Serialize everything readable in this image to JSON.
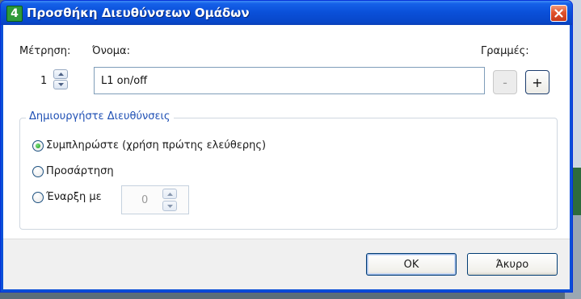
{
  "window": {
    "title": "Προσθήκη Διευθύνσεων Ομάδων",
    "app_icon_glyph": "4",
    "close_glyph": "✕"
  },
  "form": {
    "count_label": "Μέτρηση:",
    "count_value": "1",
    "name_label": "Όνομα:",
    "name_value": "L1 on/off",
    "lines_label": "Γραμμές:",
    "minus_label": "-",
    "plus_label": "+"
  },
  "addresses_group": {
    "legend": "Δημιουργήστε Διευθύνσεις",
    "options": [
      {
        "label": "Συμπληρώστε (χρήση πρώτης ελεύθερης)",
        "checked": true
      },
      {
        "label": "Προσάρτηση",
        "checked": false
      },
      {
        "label": "Έναρξη με",
        "checked": false
      }
    ],
    "start_value": "0"
  },
  "footer": {
    "ok_label": "OK",
    "cancel_label": "Άκυρο"
  },
  "colors": {
    "titlebar": "#0a4fd8",
    "legend_text": "#1e4fb4",
    "close_button": "#e0522c"
  }
}
